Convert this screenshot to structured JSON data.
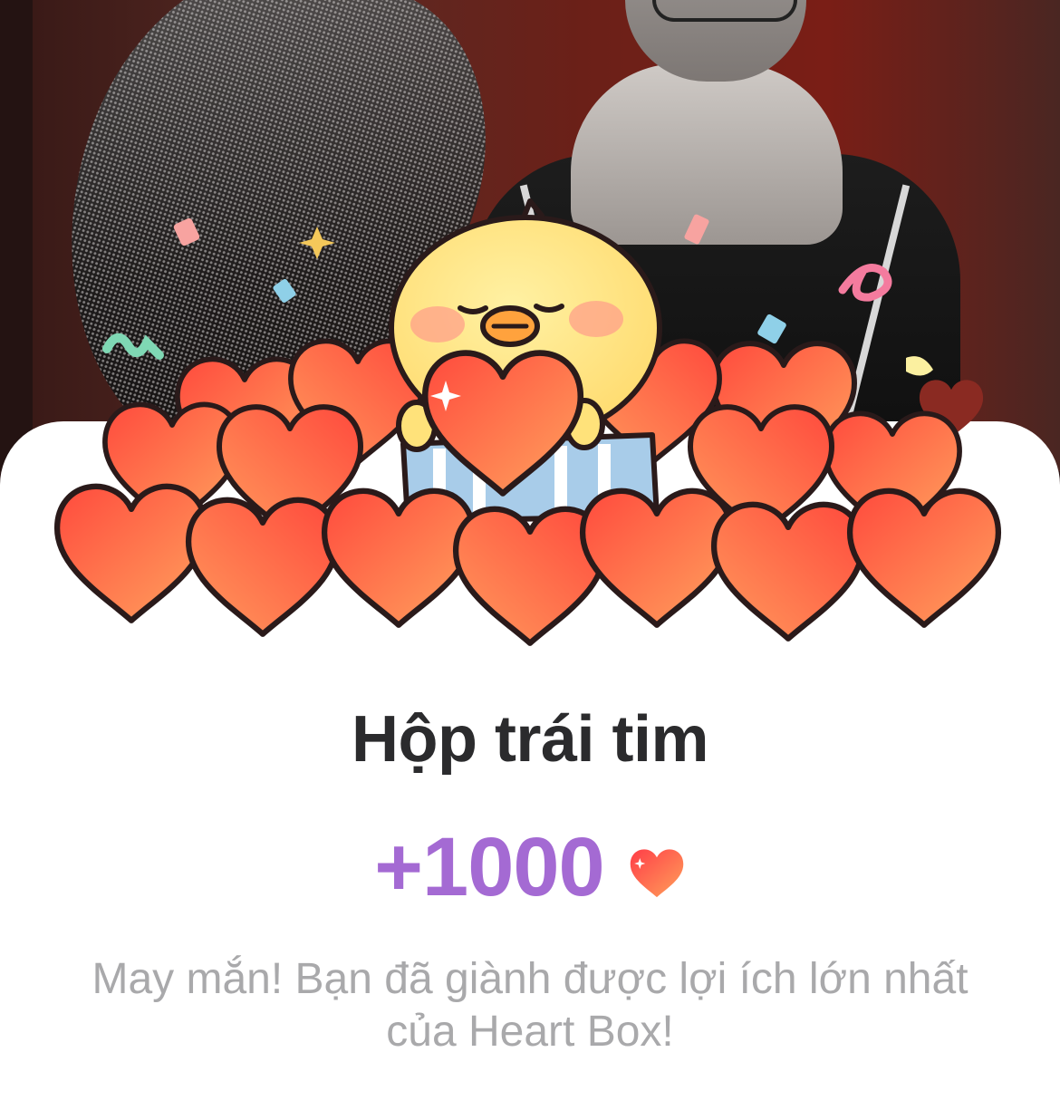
{
  "dialog": {
    "title": "Hộp trái tim",
    "reward_amount": "+1000",
    "reward_icon": "heart-icon",
    "message": "May mắn! Bạn đã giành được lợi ích lớn nhất của Heart Box!"
  },
  "colors": {
    "title": "#2b2b2d",
    "reward": "#a46ad3",
    "message": "#a9a9ab",
    "heart_light": "#ff9a5c",
    "heart_dark": "#ff4a3d",
    "chick": "#ffe27a"
  }
}
